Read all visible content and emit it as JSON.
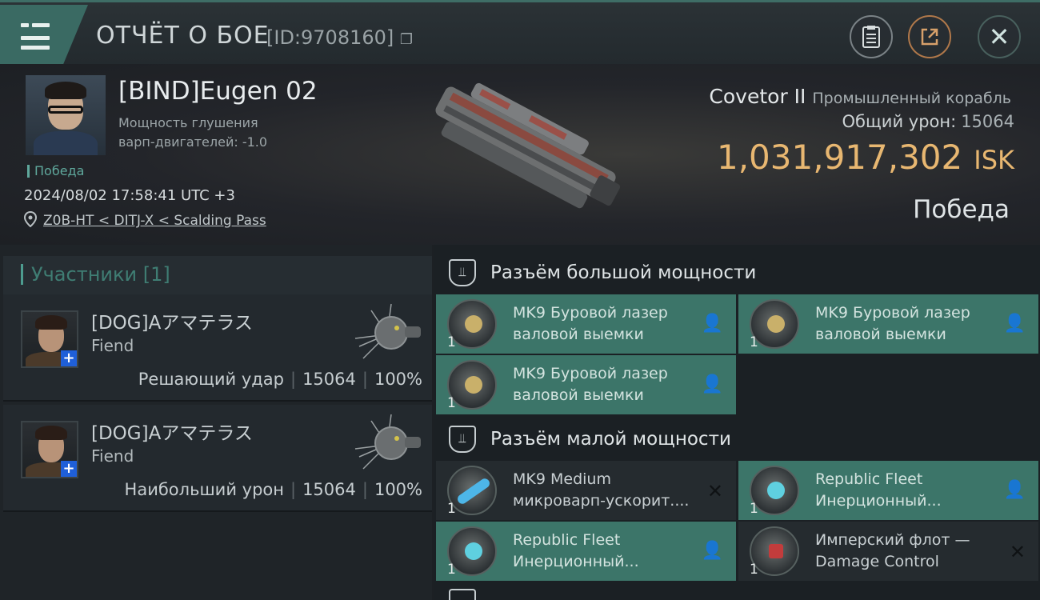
{
  "header": {
    "title": "ОТЧЁТ О БОЕ",
    "id_text": "[ID:9708160]",
    "icons": [
      "clipboard-icon",
      "export-icon",
      "close-icon"
    ]
  },
  "victim": {
    "name": "[BIND]Eugen 02",
    "stat_line1": "Мощность глушения",
    "stat_line2": "варп-двигателей: -1.0",
    "result_tag": "Победа",
    "timestamp": "2024/08/02 17:58:41 UTC +3",
    "location": "Z0B-HT < DITJ-X < Scalding Pass",
    "ship_name": "Covetor II",
    "ship_class": "Промышленный корабль",
    "total_damage_label": "Общий урон:",
    "total_damage_value": "15064",
    "isk_value": "1,031,917,302",
    "isk_unit": "ISK",
    "outcome": "Победа"
  },
  "participants": {
    "header": "Участники [1]",
    "rows": [
      {
        "name": "[DOG]Aアマテラス",
        "ship": "Fiend",
        "role": "Решающий удар",
        "damage": "15064",
        "percent": "100%"
      },
      {
        "name": "[DOG]Aアマテラス",
        "ship": "Fiend",
        "role": "Наибольший урон",
        "damage": "15064",
        "percent": "100%"
      }
    ]
  },
  "fitting": {
    "high_slot_title": "Разъём большой мощности",
    "low_slot_title": "Разъём малой мощности",
    "high_modules": [
      {
        "line1": "MK9 Буровой лазер",
        "line2": "валовой выемки",
        "qty": "1",
        "state": "pilot-icon"
      },
      {
        "line1": "MK9 Буровой лазер",
        "line2": "валовой выемки",
        "qty": "1",
        "state": "pilot-icon"
      },
      {
        "line1": "MK9 Буровой лазер",
        "line2": "валовой выемки",
        "qty": "1",
        "state": "pilot-icon"
      }
    ],
    "low_modules": [
      {
        "line1": "MK9 Medium",
        "line2": "микроварп-ускорит....",
        "qty": "1",
        "state": "destroyed-icon"
      },
      {
        "line1": "Republic Fleet",
        "line2": "Инерционный...",
        "qty": "1",
        "state": "pilot-icon"
      },
      {
        "line1": "Republic Fleet",
        "line2": "Инерционный...",
        "qty": "1",
        "state": "pilot-icon"
      },
      {
        "line1": "Имперский флот —",
        "line2": "Damage Control",
        "qty": "1",
        "state": "destroyed-icon"
      }
    ]
  },
  "colors": {
    "accent_teal": "#3c7569",
    "isk_gold": "#e8b771",
    "win_green": "#5fa89c"
  }
}
